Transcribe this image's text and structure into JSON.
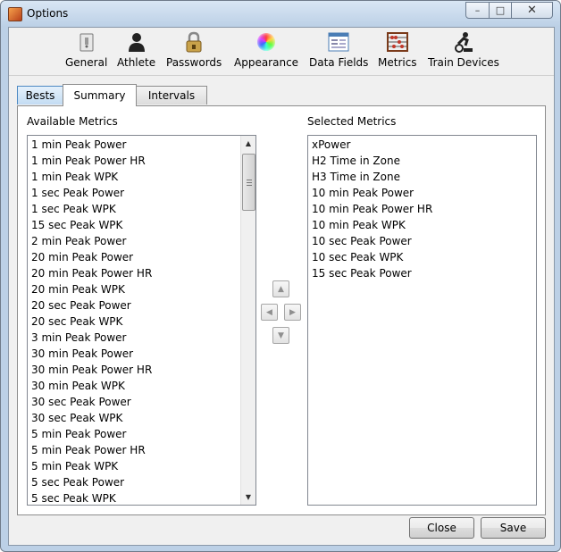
{
  "window": {
    "title": "Options"
  },
  "toolbar": {
    "items": [
      {
        "label": "General",
        "icon": "general-icon"
      },
      {
        "label": "Athlete",
        "icon": "athlete-icon"
      },
      {
        "label": "Passwords",
        "icon": "padlock-icon"
      },
      {
        "label": "Appearance",
        "icon": "color-wheel-icon"
      },
      {
        "label": "Data Fields",
        "icon": "data-fields-icon"
      },
      {
        "label": "Metrics",
        "icon": "abacus-icon"
      },
      {
        "label": "Train Devices",
        "icon": "cyclist-trainer-icon"
      }
    ]
  },
  "tabs": [
    {
      "label": "Bests",
      "state": "inactive"
    },
    {
      "label": "Summary",
      "state": "selected"
    },
    {
      "label": "Intervals",
      "state": "inactive"
    }
  ],
  "available": {
    "label": "Available Metrics",
    "items": [
      "1 min Peak Power",
      "1 min Peak Power HR",
      "1 min Peak WPK",
      "1 sec Peak Power",
      "1 sec Peak WPK",
      "15 sec Peak WPK",
      "2 min Peak Power",
      "20 min Peak Power",
      "20 min Peak Power HR",
      "20 min Peak WPK",
      "20 sec Peak Power",
      "20 sec Peak WPK",
      "3 min Peak Power",
      "30 min Peak Power",
      "30 min Peak Power HR",
      "30 min Peak WPK",
      "30 sec Peak Power",
      "30 sec Peak WPK",
      "5 min Peak Power",
      "5 min Peak Power HR",
      "5 min Peak WPK",
      "5 sec Peak Power",
      "5 sec Peak WPK"
    ]
  },
  "selected": {
    "label": "Selected Metrics",
    "items": [
      "xPower",
      "H2 Time in Zone",
      "H3 Time in Zone",
      "10 min Peak Power",
      "10 min Peak Power HR",
      "10 min Peak WPK",
      "10 sec Peak Power",
      "10 sec Peak WPK",
      "15 sec Peak Power"
    ]
  },
  "buttons": {
    "close": "Close",
    "save": "Save"
  }
}
